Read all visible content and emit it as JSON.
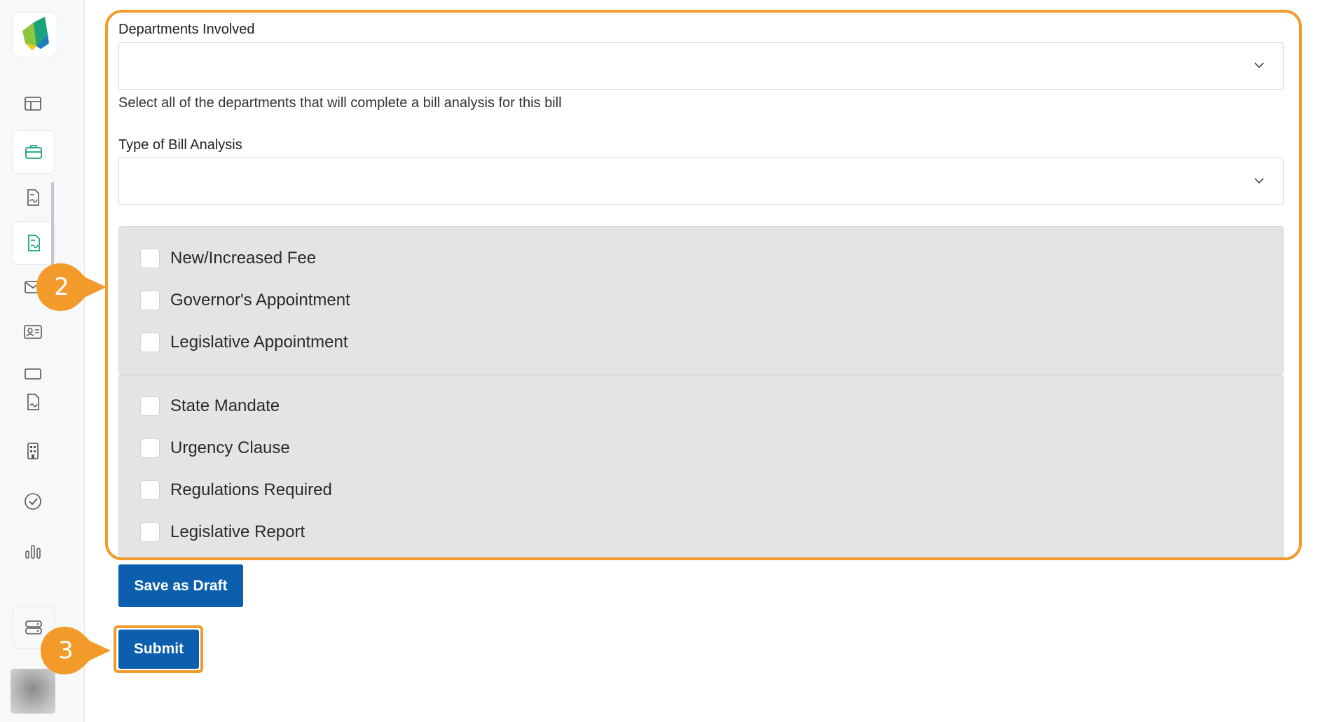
{
  "sidebar": {
    "icons": [
      "logo-icon",
      "layout-icon",
      "briefcase-icon",
      "document-icon",
      "document-active-icon",
      "mail-icon",
      "contact-card-icon",
      "card-icon",
      "document-signature-icon",
      "building-icon",
      "check-circle-icon",
      "bar-chart-icon",
      "server-icon"
    ],
    "active_icons": [
      "briefcase-icon",
      "document-active-icon"
    ],
    "accent_color": "#1aa37a"
  },
  "form": {
    "departments_label": "Departments Involved",
    "departments_value": "",
    "departments_help": "Select all of the departments that will complete a bill analysis for this bill",
    "bill_analysis_label": "Type of Bill Analysis",
    "bill_analysis_value": "",
    "group1": [
      {
        "label": "New/Increased Fee",
        "checked": false
      },
      {
        "label": "Governor's Appointment",
        "checked": false
      },
      {
        "label": "Legislative Appointment",
        "checked": false
      }
    ],
    "group2": [
      {
        "label": "State Mandate",
        "checked": false
      },
      {
        "label": "Urgency Clause",
        "checked": false
      },
      {
        "label": "Regulations Required",
        "checked": false
      },
      {
        "label": "Legislative Report",
        "checked": false
      }
    ]
  },
  "actions": {
    "save_draft_label": "Save as Draft",
    "submit_label": "Submit",
    "button_color": "#0b5fad"
  },
  "annotations": {
    "step2": "2",
    "step3": "3",
    "highlight_color": "#f29b2b"
  }
}
